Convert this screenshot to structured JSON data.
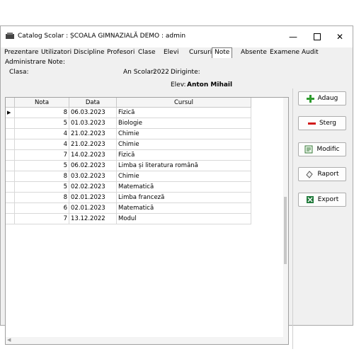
{
  "window": {
    "title": "Catalog Scolar : ȘCOALA GIMNAZIALĂ DEMO : admin"
  },
  "tabs": [
    "Prezentare",
    "Utilizatori",
    "Discipline",
    "Profesori",
    "Clase",
    "Elevi",
    "Cursuri",
    "Note",
    "Absente",
    "Examene",
    "Audit"
  ],
  "active_tab": "Note",
  "panel": {
    "heading": "Administrare Note:",
    "clasa_label": "Clasa:",
    "an_scolar_label": "An Scolar:",
    "an_scolar_value": "2022",
    "diriginte_label": "Diriginte:",
    "elev_label": "Elev:",
    "elev_value": "Anton Mihail"
  },
  "grid": {
    "columns": [
      "Nota",
      "Data",
      "Cursul"
    ],
    "rows": [
      {
        "nota": "8",
        "data": "06.03.2023",
        "cursul": "Fizică"
      },
      {
        "nota": "5",
        "data": "01.03.2023",
        "cursul": "Biologie"
      },
      {
        "nota": "4",
        "data": "21.02.2023",
        "cursul": "Chimie"
      },
      {
        "nota": "4",
        "data": "21.02.2023",
        "cursul": "Chimie"
      },
      {
        "nota": "7",
        "data": "14.02.2023",
        "cursul": "Fizică"
      },
      {
        "nota": "5",
        "data": "06.02.2023",
        "cursul": "Limba și literatura română"
      },
      {
        "nota": "8",
        "data": "03.02.2023",
        "cursul": "Chimie"
      },
      {
        "nota": "5",
        "data": "02.02.2023",
        "cursul": "Matematică"
      },
      {
        "nota": "8",
        "data": "02.01.2023",
        "cursul": "Limba franceză"
      },
      {
        "nota": "6",
        "data": "02.01.2023",
        "cursul": "Matematică"
      },
      {
        "nota": "7",
        "data": "13.12.2022",
        "cursul": "Modul"
      }
    ]
  },
  "actions": {
    "add": {
      "label": "Adaug",
      "icon": "plus-icon",
      "color": "#2e9b2e"
    },
    "delete": {
      "label": "Sterg",
      "icon": "minus-icon",
      "color": "#d11a1a"
    },
    "edit": {
      "label": "Modific",
      "icon": "edit-document-icon"
    },
    "report": {
      "label": "Raport",
      "icon": "report-icon"
    },
    "export": {
      "label": "Export",
      "icon": "excel-icon"
    }
  }
}
